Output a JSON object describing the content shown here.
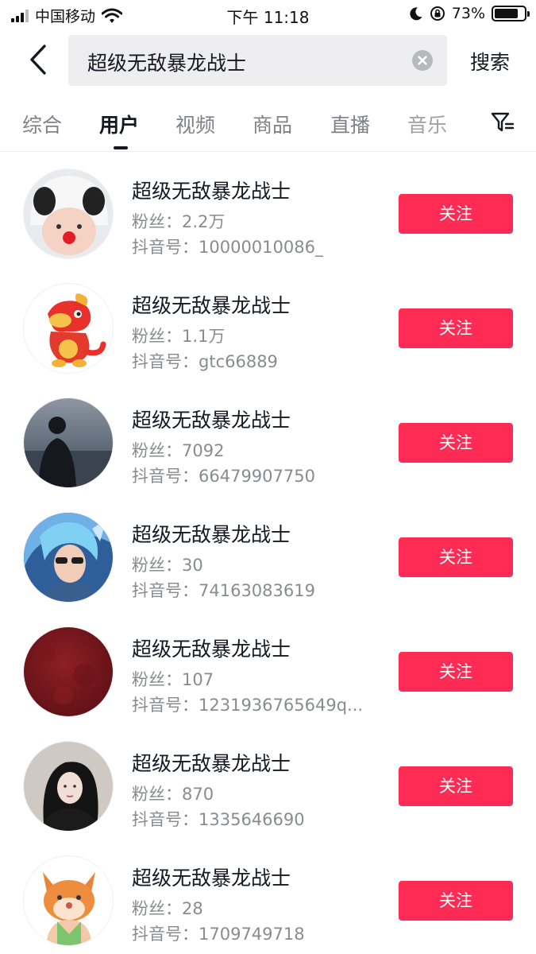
{
  "status_bar": {
    "carrier": "中国移动",
    "time": "下午 11:18",
    "battery": "73%",
    "battery_level": 0.73,
    "icons": [
      "signal-icon",
      "wifi-icon",
      "moon-icon",
      "rotation-lock-icon",
      "battery-icon"
    ]
  },
  "search": {
    "query": "超级无敌暴龙战士",
    "search_label": "搜索",
    "icons": [
      "back-icon",
      "clear-icon"
    ]
  },
  "tabs": [
    {
      "label": "综合"
    },
    {
      "label": "用户",
      "active": true
    },
    {
      "label": "视频"
    },
    {
      "label": "商品"
    },
    {
      "label": "直播"
    },
    {
      "label": "音乐"
    }
  ],
  "filter_icon": "filter-icon",
  "colors": {
    "accent": "#fe2c55",
    "text_primary": "#161823",
    "text_secondary": "#8a8b91"
  },
  "users": [
    {
      "name": "超级无敌暴龙战士",
      "fans": "粉丝：2.2万",
      "douyin_id": "抖音号：10000010086_",
      "follow": "关注",
      "avatar": "panda-hat-baby"
    },
    {
      "name": "超级无敌暴龙战士",
      "fans": "粉丝：1.1万",
      "douyin_id": "抖音号：gtc66889",
      "follow": "关注",
      "avatar": "red-dinosaur"
    },
    {
      "name": "超级无敌暴龙战士",
      "fans": "粉丝：7092",
      "douyin_id": "抖音号：66479907750",
      "follow": "关注",
      "avatar": "silhouette-by-sea"
    },
    {
      "name": "超级无敌暴龙战士",
      "fans": "粉丝：30",
      "douyin_id": "抖音号：74163083619",
      "follow": "关注",
      "avatar": "blue-hair-game-character"
    },
    {
      "name": "超级无敌暴龙战士",
      "fans": "粉丝：107",
      "douyin_id": "抖音号：1231936765649q...",
      "follow": "关注",
      "avatar": "dark-red-texture"
    },
    {
      "name": "超级无敌暴龙战士",
      "fans": "粉丝：870",
      "douyin_id": "抖音号：1335646690",
      "follow": "关注",
      "avatar": "woman-portrait"
    },
    {
      "name": "超级无敌暴龙战士",
      "fans": "粉丝：28",
      "douyin_id": "抖音号：1709749718",
      "follow": "关注",
      "avatar": "cartoon-fox"
    }
  ]
}
